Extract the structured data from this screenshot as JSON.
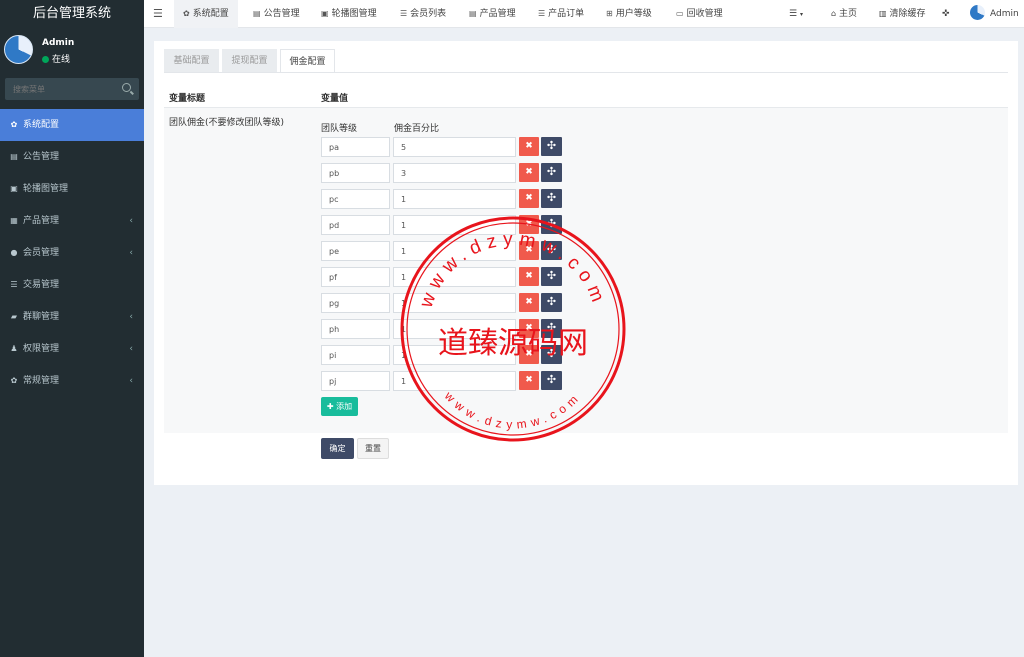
{
  "app": {
    "title": "后台管理系统"
  },
  "user": {
    "name": "Admin",
    "status": "在线"
  },
  "search": {
    "placeholder": "搜索菜单"
  },
  "sidebar": {
    "items": [
      {
        "label": "系统配置",
        "icon": "gear-icon",
        "active": true
      },
      {
        "label": "公告管理",
        "icon": "file-icon"
      },
      {
        "label": "轮播图管理",
        "icon": "image-icon"
      },
      {
        "label": "产品管理",
        "icon": "grid-icon",
        "arrow": true
      },
      {
        "label": "会员管理",
        "icon": "user-icon",
        "arrow": true
      },
      {
        "label": "交易管理",
        "icon": "list-icon"
      },
      {
        "label": "群聊管理",
        "icon": "comments-icon",
        "arrow": true
      },
      {
        "label": "权限管理",
        "icon": "group-icon",
        "arrow": true
      },
      {
        "label": "常规管理",
        "icon": "cogs-icon",
        "arrow": true
      }
    ]
  },
  "topnav": {
    "tabs": [
      {
        "label": "系统配置",
        "icon": "gear-icon"
      },
      {
        "label": "公告管理",
        "icon": "file-icon"
      },
      {
        "label": "轮播图管理",
        "icon": "image-icon"
      },
      {
        "label": "会员列表",
        "icon": "list-icon"
      },
      {
        "label": "产品管理",
        "icon": "list-icon"
      },
      {
        "label": "产品订单",
        "icon": "menu-icon"
      },
      {
        "label": "用户等级",
        "icon": "sitemap-icon"
      },
      {
        "label": "回收管理",
        "icon": "card-icon"
      }
    ],
    "home": "主页",
    "clear_cache": "清除缓存",
    "admin": "Admin"
  },
  "config_tabs": [
    "基础配置",
    "提现配置",
    "佣金配置"
  ],
  "table": {
    "col_title": "变量标题",
    "col_value": "变量值",
    "row_label": "团队佣金(不要修改团队等级)",
    "sub_col_level": "团队等级",
    "sub_col_percent": "佣金百分比",
    "rows": [
      {
        "level": "pa",
        "percent": "5"
      },
      {
        "level": "pb",
        "percent": "3"
      },
      {
        "level": "pc",
        "percent": "1"
      },
      {
        "level": "pd",
        "percent": "1"
      },
      {
        "level": "pe",
        "percent": "1"
      },
      {
        "level": "pf",
        "percent": "1"
      },
      {
        "level": "pg",
        "percent": "1"
      },
      {
        "level": "ph",
        "percent": "1"
      },
      {
        "level": "pi",
        "percent": "1"
      },
      {
        "level": "pj",
        "percent": "1"
      }
    ]
  },
  "buttons": {
    "add": "添加",
    "confirm": "确定",
    "reset": "重置"
  },
  "watermark": {
    "center_text": "道臻源码网",
    "top_text": "www.dzymw.com",
    "bottom_text": "www.dzymw.com"
  },
  "colors": {
    "sidebar": "#222d32",
    "active": "#4a7ed9",
    "danger": "#f05a4c",
    "dark": "#3e4a67",
    "success": "#18bc9c",
    "stamp": "#e8141c"
  }
}
